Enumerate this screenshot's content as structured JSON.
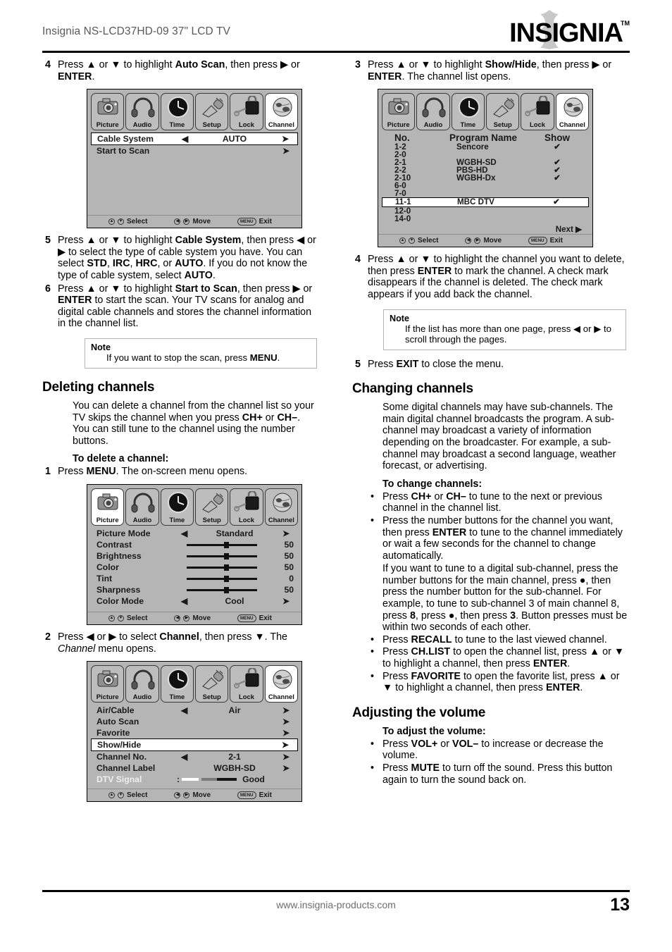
{
  "header": {
    "title": "Insignia NS-LCD37HD-09 37\" LCD TV",
    "brand": "INSIGNIA",
    "brand_tm": "TM"
  },
  "footer": {
    "url": "www.insignia-products.com",
    "page_number": "13"
  },
  "osd_common": {
    "tabs": [
      {
        "label": "Picture",
        "icon": "camera-icon"
      },
      {
        "label": "Audio",
        "icon": "headphones-icon"
      },
      {
        "label": "Time",
        "icon": "clock-icon"
      },
      {
        "label": "Setup",
        "icon": "plug-icon"
      },
      {
        "label": "Lock",
        "icon": "padlock-key-icon"
      },
      {
        "label": "Channel",
        "icon": "satellite-globe-icon"
      }
    ],
    "footer": {
      "select_key": "ⒶⓋ",
      "select_label": "Select",
      "move_key": "ⒶⒹ",
      "move_label": "Move",
      "menu_key": "MENU",
      "exit_label": "Exit"
    }
  },
  "left_column": {
    "step4": {
      "num": "4",
      "line1_a": "Press ",
      "up": "▲",
      "or": " or ",
      "down": "▼",
      "line1_b": " to highlight ",
      "bold1": "Auto Scan",
      "line1_c": ", then press ",
      "right_arrow": "▶",
      "line1_d": " or ",
      "bold2": "ENTER",
      "line1_e": "."
    },
    "osd_cable_system": {
      "active_tab": "Channel",
      "rows": [
        {
          "label": "Cable System",
          "value": "AUTO",
          "left_arrow": "◀",
          "right_arrow": "➤",
          "selected": true
        },
        {
          "label": "Start to Scan",
          "value": "",
          "left_arrow": "",
          "right_arrow": "➤",
          "selected": false
        }
      ]
    },
    "step5": {
      "num": "5",
      "text_parts": [
        {
          "t": "Press ",
          "s": "n"
        },
        {
          "t": "▲",
          "s": "n"
        },
        {
          "t": " or ",
          "s": "n"
        },
        {
          "t": "▼",
          "s": "n"
        },
        {
          "t": " to highlight ",
          "s": "n"
        },
        {
          "t": "Cable System",
          "s": "b"
        },
        {
          "t": ", then press ",
          "s": "n"
        },
        {
          "t": "◀",
          "s": "n"
        },
        {
          "t": " or ",
          "s": "n"
        },
        {
          "t": "▶",
          "s": "n"
        },
        {
          "t": " to select the type of cable system you have. You can select ",
          "s": "n"
        },
        {
          "t": "STD",
          "s": "b"
        },
        {
          "t": ", ",
          "s": "n"
        },
        {
          "t": "IRC",
          "s": "b"
        },
        {
          "t": ", ",
          "s": "n"
        },
        {
          "t": "HRC",
          "s": "b"
        },
        {
          "t": ", or ",
          "s": "n"
        },
        {
          "t": "AUTO",
          "s": "b"
        },
        {
          "t": ". If you do not know the type of cable system, select ",
          "s": "n"
        },
        {
          "t": "AUTO",
          "s": "b"
        },
        {
          "t": ".",
          "s": "n"
        }
      ]
    },
    "step6": {
      "num": "6",
      "text_parts": [
        {
          "t": "Press ",
          "s": "n"
        },
        {
          "t": "▲",
          "s": "n"
        },
        {
          "t": " or ",
          "s": "n"
        },
        {
          "t": "▼",
          "s": "n"
        },
        {
          "t": " to highlight ",
          "s": "n"
        },
        {
          "t": "Start to Scan",
          "s": "b"
        },
        {
          "t": ", then press ",
          "s": "n"
        },
        {
          "t": "▶",
          "s": "n"
        },
        {
          "t": " or ",
          "s": "n"
        },
        {
          "t": "ENTER",
          "s": "b"
        },
        {
          "t": " to start the scan. Your TV scans for analog and digital cable channels and stores the channel information in the channel list.",
          "s": "n"
        }
      ]
    },
    "note1": {
      "title": "Note",
      "text_parts": [
        {
          "t": "If you want to stop the scan, press ",
          "s": "n"
        },
        {
          "t": "MENU",
          "s": "b"
        },
        {
          "t": ".",
          "s": "n"
        }
      ]
    },
    "section_deleting": "Deleting channels",
    "deleting_para": [
      {
        "t": "You can delete a channel from the channel list so your TV skips the channel when you press ",
        "s": "n"
      },
      {
        "t": "CH+",
        "s": "b"
      },
      {
        "t": " or ",
        "s": "n"
      },
      {
        "t": "CH–",
        "s": "b"
      },
      {
        "t": ". You can still tune to the channel using the number buttons.",
        "s": "n"
      }
    ],
    "subhead_delete": "To delete a channel:",
    "step1": {
      "num": "1",
      "text_parts": [
        {
          "t": "Press ",
          "s": "n"
        },
        {
          "t": "MENU",
          "s": "b"
        },
        {
          "t": ". The on-screen menu opens.",
          "s": "n"
        }
      ]
    },
    "osd_picture": {
      "active_tab": "Picture",
      "rows": [
        {
          "label": "Picture Mode",
          "type": "choice",
          "value": "Standard",
          "left_arrow": "◀",
          "right_arrow": "➤"
        },
        {
          "label": "Contrast",
          "type": "slider",
          "value": "50",
          "pos": 50
        },
        {
          "label": "Brightness",
          "type": "slider",
          "value": "50",
          "pos": 50
        },
        {
          "label": "Color",
          "type": "slider",
          "value": "50",
          "pos": 50
        },
        {
          "label": "Tint",
          "type": "slider",
          "value": "0",
          "pos": 50
        },
        {
          "label": "Sharpness",
          "type": "slider",
          "value": "50",
          "pos": 50
        },
        {
          "label": "Color Mode",
          "type": "choice",
          "value": "Cool",
          "left_arrow": "◀",
          "right_arrow": "➤"
        }
      ]
    },
    "step2": {
      "num": "2",
      "text_parts": [
        {
          "t": "Press ",
          "s": "n"
        },
        {
          "t": "◀",
          "s": "n"
        },
        {
          "t": " or ",
          "s": "n"
        },
        {
          "t": "▶",
          "s": "n"
        },
        {
          "t": " to select ",
          "s": "n"
        },
        {
          "t": "Channel",
          "s": "b"
        },
        {
          "t": ", then press ",
          "s": "n"
        },
        {
          "t": "▼",
          "s": "n"
        },
        {
          "t": ". The ",
          "s": "n"
        },
        {
          "t": "Channel",
          "s": "i"
        },
        {
          "t": " menu opens.",
          "s": "n"
        }
      ]
    },
    "osd_channel": {
      "active_tab": "Channel",
      "rows": [
        {
          "label": "Air/Cable",
          "type": "choice",
          "value": "Air",
          "left_arrow": "◀",
          "right_arrow": "➤",
          "selected": false
        },
        {
          "label": "Auto Scan",
          "type": "action",
          "value": "",
          "right_arrow": "➤",
          "selected": false
        },
        {
          "label": "Favorite",
          "type": "action",
          "value": "",
          "right_arrow": "➤",
          "selected": false
        },
        {
          "label": "Show/Hide",
          "type": "action",
          "value": "",
          "right_arrow": "➤",
          "selected": true
        },
        {
          "label": "Channel No.",
          "type": "choice",
          "value": "2-1",
          "left_arrow": "◀",
          "right_arrow": "➤",
          "selected": false
        },
        {
          "label": "Channel Label",
          "type": "choice",
          "value": "WGBH-SD",
          "left_arrow": "",
          "right_arrow": "➤",
          "selected": false
        },
        {
          "label": "DTV Signal",
          "type": "signal",
          "value": "Good",
          "prefix": ":",
          "selected": false
        }
      ]
    }
  },
  "right_column": {
    "step3": {
      "num": "3",
      "text_parts": [
        {
          "t": "Press ",
          "s": "n"
        },
        {
          "t": "▲",
          "s": "n"
        },
        {
          "t": " or ",
          "s": "n"
        },
        {
          "t": "▼",
          "s": "n"
        },
        {
          "t": " to highlight ",
          "s": "n"
        },
        {
          "t": "Show/Hide",
          "s": "b"
        },
        {
          "t": ", then press ",
          "s": "n"
        },
        {
          "t": "▶",
          "s": "n"
        },
        {
          "t": " or ",
          "s": "n"
        },
        {
          "t": "ENTER",
          "s": "b"
        },
        {
          "t": ". The channel list opens.",
          "s": "n"
        }
      ]
    },
    "osd_channel_list": {
      "active_tab": "Channel",
      "columns": [
        "No.",
        "Program Name",
        "Show"
      ],
      "rows": [
        {
          "no": "1-2",
          "name": "Sencore",
          "show": "✔",
          "selected": false
        },
        {
          "no": "2-0",
          "name": "",
          "show": "",
          "selected": false
        },
        {
          "no": "2-1",
          "name": "WGBH-SD",
          "show": "✔",
          "selected": false
        },
        {
          "no": "2-2",
          "name": "PBS-HD",
          "show": "✔",
          "selected": false
        },
        {
          "no": "2-10",
          "name": "WGBH-Dx",
          "show": "✔",
          "selected": false
        },
        {
          "no": "6-0",
          "name": "",
          "show": "",
          "selected": false
        },
        {
          "no": "7-0",
          "name": "",
          "show": "",
          "selected": false
        },
        {
          "no": "11-1",
          "name": "MBC DTV",
          "show": "✔",
          "selected": true
        },
        {
          "no": "12-0",
          "name": "",
          "show": "",
          "selected": false
        },
        {
          "no": "14-0",
          "name": "",
          "show": "",
          "selected": false
        }
      ],
      "next_label": "Next ▶"
    },
    "step4": {
      "num": "4",
      "text_parts": [
        {
          "t": "Press ",
          "s": "n"
        },
        {
          "t": "▲",
          "s": "n"
        },
        {
          "t": " or ",
          "s": "n"
        },
        {
          "t": "▼",
          "s": "n"
        },
        {
          "t": " to highlight the channel you want to delete, then press ",
          "s": "n"
        },
        {
          "t": "ENTER",
          "s": "b"
        },
        {
          "t": " to mark the channel. A check mark disappears if the channel is deleted. The check mark appears if you add back the channel.",
          "s": "n"
        }
      ]
    },
    "note2": {
      "title": "Note",
      "text_parts": [
        {
          "t": "If the list has more than one page, press ",
          "s": "n"
        },
        {
          "t": "◀",
          "s": "n"
        },
        {
          "t": " or ",
          "s": "n"
        },
        {
          "t": "▶",
          "s": "n"
        },
        {
          "t": " to scroll through the pages.",
          "s": "n"
        }
      ]
    },
    "step5": {
      "num": "5",
      "text_parts": [
        {
          "t": "Press ",
          "s": "n"
        },
        {
          "t": "EXIT",
          "s": "b"
        },
        {
          "t": " to close the menu.",
          "s": "n"
        }
      ]
    },
    "section_changing": "Changing channels",
    "changing_para": [
      {
        "t": "Some digital channels may have sub-channels. The main digital channel broadcasts the program. A sub-channel may broadcast a variety of information depending on the broadcaster. For example, a sub-channel may broadcast a second language, weather forecast, or advertising.",
        "s": "n"
      }
    ],
    "subhead_change": "To change channels:",
    "bullets_change": [
      {
        "dot": "•",
        "parts": [
          {
            "t": "Press ",
            "s": "n"
          },
          {
            "t": "CH+",
            "s": "b"
          },
          {
            "t": " or ",
            "s": "n"
          },
          {
            "t": "CH–",
            "s": "b"
          },
          {
            "t": " to tune to the next or previous channel in the channel list.",
            "s": "n"
          }
        ]
      },
      {
        "dot": "•",
        "parts": [
          {
            "t": "Press the number buttons for the channel you want, then press ",
            "s": "n"
          },
          {
            "t": "ENTER",
            "s": "b"
          },
          {
            "t": " to tune to the channel immediately or wait a few seconds for the channel to change automatically.",
            "s": "n"
          }
        ]
      }
    ],
    "subchannel_para": [
      {
        "t": "If you want to tune to a digital sub-channel, press the number buttons for the main channel, press ",
        "s": "n"
      },
      {
        "t": "●",
        "s": "n"
      },
      {
        "t": ", then press the number button for the sub-channel. For example, to tune to sub-channel 3 of main channel 8, press ",
        "s": "n"
      },
      {
        "t": "8",
        "s": "b"
      },
      {
        "t": ", press ",
        "s": "n"
      },
      {
        "t": "●",
        "s": "n"
      },
      {
        "t": ", then press ",
        "s": "n"
      },
      {
        "t": "3",
        "s": "b"
      },
      {
        "t": ". Button presses must be within two seconds of each other.",
        "s": "n"
      }
    ],
    "bullets_change2": [
      {
        "dot": "•",
        "parts": [
          {
            "t": "Press ",
            "s": "n"
          },
          {
            "t": "RECALL",
            "s": "b"
          },
          {
            "t": " to tune to the last viewed channel.",
            "s": "n"
          }
        ]
      },
      {
        "dot": "•",
        "parts": [
          {
            "t": "Press ",
            "s": "n"
          },
          {
            "t": "CH.LIST",
            "s": "b"
          },
          {
            "t": " to open the channel list, press ",
            "s": "n"
          },
          {
            "t": "▲",
            "s": "n"
          },
          {
            "t": " or ",
            "s": "n"
          },
          {
            "t": "▼",
            "s": "n"
          },
          {
            "t": " to highlight a channel, then press ",
            "s": "n"
          },
          {
            "t": "ENTER",
            "s": "b"
          },
          {
            "t": ".",
            "s": "n"
          }
        ]
      },
      {
        "dot": "•",
        "parts": [
          {
            "t": "Press ",
            "s": "n"
          },
          {
            "t": "FAVORITE",
            "s": "b"
          },
          {
            "t": " to open the favorite list, press ",
            "s": "n"
          },
          {
            "t": "▲",
            "s": "n"
          },
          {
            "t": " or ",
            "s": "n"
          },
          {
            "t": "▼",
            "s": "n"
          },
          {
            "t": " to highlight a channel, then press ",
            "s": "n"
          },
          {
            "t": "ENTER",
            "s": "b"
          },
          {
            "t": ".",
            "s": "n"
          }
        ]
      }
    ],
    "section_volume": "Adjusting the volume",
    "subhead_volume": "To adjust the volume:",
    "bullets_volume": [
      {
        "dot": "•",
        "parts": [
          {
            "t": "Press ",
            "s": "n"
          },
          {
            "t": "VOL+",
            "s": "b"
          },
          {
            "t": " or ",
            "s": "n"
          },
          {
            "t": "VOL–",
            "s": "b"
          },
          {
            "t": " to increase or decrease the volume.",
            "s": "n"
          }
        ]
      },
      {
        "dot": "•",
        "parts": [
          {
            "t": "Press ",
            "s": "n"
          },
          {
            "t": "MUTE",
            "s": "b"
          },
          {
            "t": " to turn off the sound. Press this button again to turn the sound back on.",
            "s": "n"
          }
        ]
      }
    ]
  }
}
